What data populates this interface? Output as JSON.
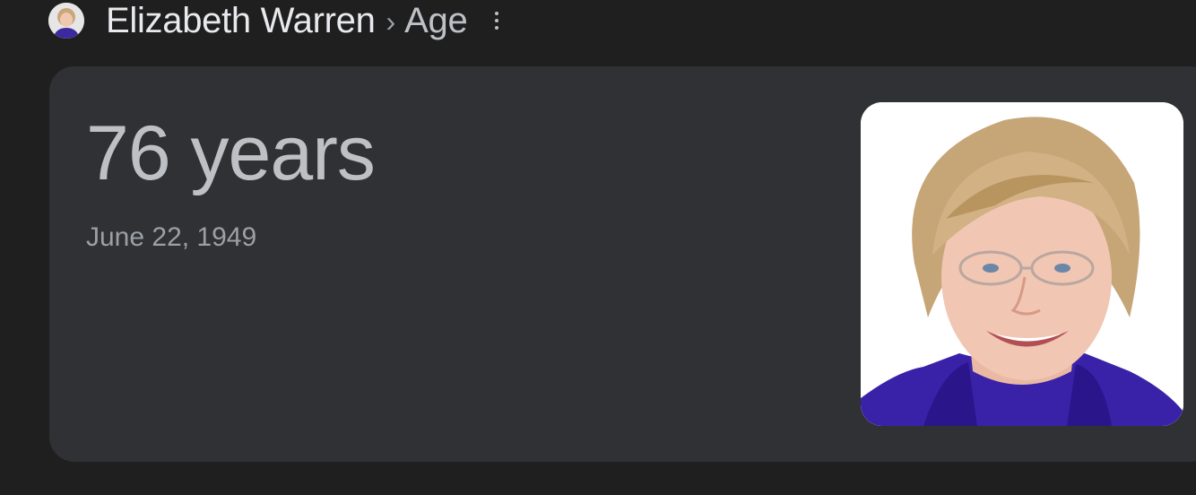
{
  "header": {
    "entity": "Elizabeth Warren",
    "separator": "›",
    "attribute": "Age"
  },
  "answer": {
    "age": "76 years",
    "birth_date": "June 22, 1949"
  },
  "colors": {
    "page_background": "#1f1f1f",
    "card_background": "#303134",
    "primary_text": "#e8eaed",
    "secondary_text": "#bdc1c6",
    "muted_text": "#9aa0a6"
  },
  "icons": {
    "avatar": "person-thumbnail",
    "menu": "more-vert-icon"
  }
}
